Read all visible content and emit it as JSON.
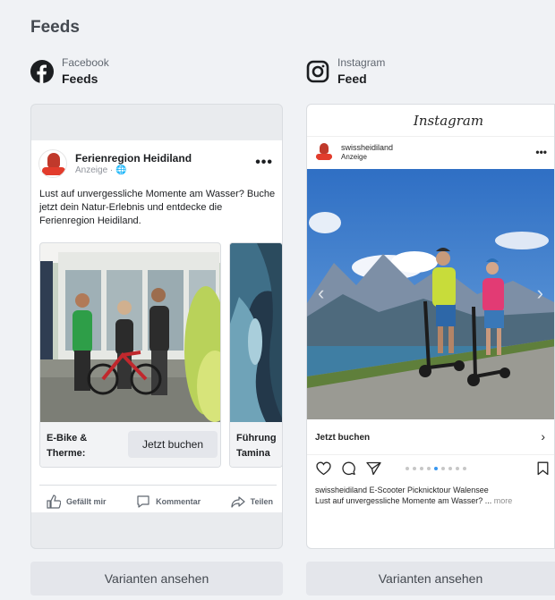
{
  "section_title": "Feeds",
  "placements": {
    "facebook": {
      "platform": "Facebook",
      "placement": "Feeds",
      "icon": "facebook-logo-icon"
    },
    "instagram": {
      "platform": "Instagram",
      "placement": "Feed",
      "icon": "instagram-logo-icon"
    }
  },
  "facebook_ad": {
    "page_name": "Ferienregion Heidiland",
    "sponsored": "Anzeige · 🌐",
    "primary_text": "Lust auf unvergessliche Momente am Wasser? Buche jetzt dein Natur-Erlebnis und entdecke die Ferienregion Heidiland.",
    "cards": [
      {
        "title": "E-Bike & Therme:",
        "cta": "Jetzt buchen"
      },
      {
        "title": "Führung Tamina"
      }
    ],
    "actions": {
      "like": "Gefällt mir",
      "comment": "Kommentar",
      "share": "Teilen"
    }
  },
  "instagram_ad": {
    "wordmark": "Instagram",
    "username": "swissheidiland",
    "sponsored": "Anzeige",
    "cta": "Jetzt buchen",
    "carousel_dots": {
      "count": 9,
      "active": 4
    },
    "caption_line1": "swissheidiland E-Scooter Picknicktour Walensee",
    "caption_line2": "Lust auf unvergessliche Momente am Wasser? ...",
    "more": "more"
  },
  "buttons": {
    "variants_facebook": "Varianten ansehen",
    "variants_instagram": "Varianten ansehen"
  },
  "colors": {
    "fb_blue": "#1877f2",
    "ig_active_dot": "#3897f0",
    "button_bg": "#e4e6eb"
  }
}
